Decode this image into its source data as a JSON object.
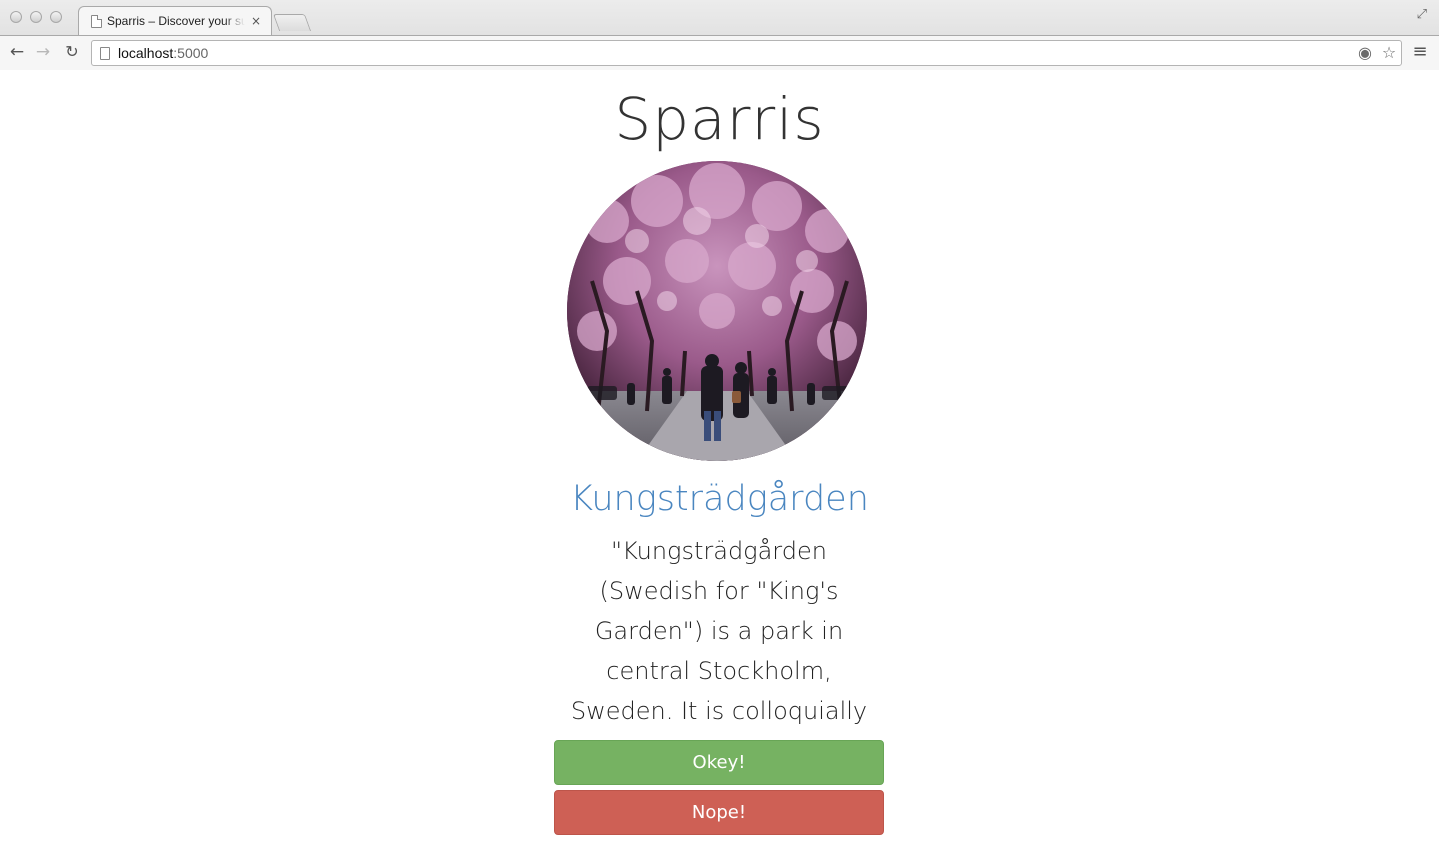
{
  "browser": {
    "tab_title": "Sparris – Discover your surroundings",
    "tab_close": "×",
    "url_host": "localhost",
    "url_port": ":5000",
    "icons": [
      "back-arrow-icon",
      "forward-arrow-icon",
      "reload-icon",
      "page-icon",
      "location-icon",
      "star-icon",
      "menu-icon",
      "fullscreen-icon"
    ]
  },
  "page": {
    "site_title": "Sparris",
    "place": {
      "name": "Kungsträdgården",
      "description": "\"Kungsträdgården (Swedish for \"King's Garden\") is a park in central Stockholm, Sweden. It is colloquially known as Kungsan.\""
    },
    "buttons": {
      "accept_label": "Okey!",
      "reject_label": "Nope!"
    }
  },
  "colors": {
    "title_text": "#333333",
    "place_name": "#4a86c0",
    "accept_button": "#76b262",
    "reject_button": "#ce6055"
  }
}
